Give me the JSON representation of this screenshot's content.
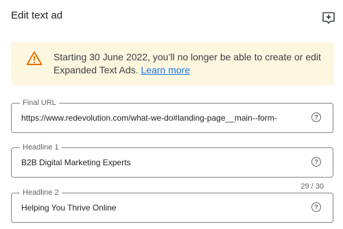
{
  "dialog": {
    "title": "Edit text ad",
    "feedback_icon": "feedback-plus-icon"
  },
  "notice": {
    "icon": "warning-icon",
    "message": "Starting 30 June 2022, you’ll no longer be able to create or edit Expanded Text Ads.",
    "link_text": "Learn more",
    "background": "#fef7e0",
    "icon_color": "#e37400"
  },
  "fields": {
    "final_url": {
      "label": "Final URL",
      "value": "https://www.redevolution.com/what-we-do#landing-page__main--form-"
    },
    "headline1": {
      "label": "Headline 1",
      "value": "B2B Digital Marketing Experts"
    },
    "headline2": {
      "label": "Headline 2",
      "value": "Helping You Thrive Online",
      "counter": "29 / 30"
    },
    "help_icon": "help-circle-icon"
  },
  "colors": {
    "link": "#1a73e8",
    "border": "#80868b"
  }
}
